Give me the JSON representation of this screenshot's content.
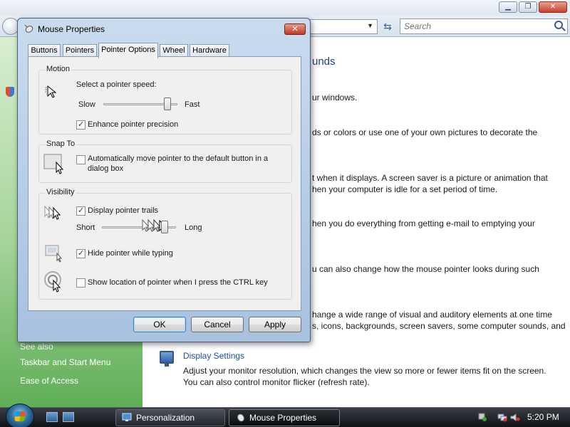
{
  "background_window": {
    "search": {
      "placeholder": "Search"
    },
    "heading_fragment": "unds",
    "lines": [
      "ur windows.",
      "ds or colors or use one of your own pictures to decorate the",
      "t when it displays. A screen saver is a picture or animation that",
      "hen your computer is idle for a set period of time.",
      "hen you do everything from getting e-mail to emptying your",
      "u can also change how the mouse pointer looks during such",
      "hange a wide range of visual and auditory elements at one time",
      "s, icons, backgrounds, screen savers, some computer sounds, and"
    ],
    "display_settings": {
      "link": "Display Settings",
      "desc_line1": "Adjust your monitor resolution, which changes the view so more or fewer items fit on the screen.",
      "desc_line2": "You can also control monitor flicker (refresh rate)."
    },
    "see_also": {
      "title": "See also",
      "links": [
        "Taskbar and Start Menu",
        "Ease of Access"
      ]
    }
  },
  "dialog": {
    "title": "Mouse Properties",
    "close_label": "✕",
    "tabs": [
      "Buttons",
      "Pointers",
      "Pointer Options",
      "Wheel",
      "Hardware"
    ],
    "active_tab": "Pointer Options",
    "motion": {
      "title": "Motion",
      "label": "Select a pointer speed:",
      "slow": "Slow",
      "fast": "Fast",
      "speed_fraction": 0.9,
      "enhance_label": "Enhance pointer precision",
      "enhance_checked": true
    },
    "snap_to": {
      "title": "Snap To",
      "label_line1": "Automatically move pointer to the default button in a",
      "label_line2": "dialog box",
      "checked": false
    },
    "visibility": {
      "title": "Visibility",
      "trails_label": "Display pointer trails",
      "trails_checked": true,
      "short": "Short",
      "long": "Long",
      "trail_fraction": 0.88,
      "hide_label": "Hide pointer while typing",
      "hide_checked": true,
      "ctrl_label": "Show location of pointer when I press the CTRL key",
      "ctrl_checked": false
    },
    "buttons": {
      "ok": "OK",
      "cancel": "Cancel",
      "apply": "Apply"
    }
  },
  "taskbar": {
    "items": [
      "Personalization",
      "Mouse Properties"
    ],
    "active": "Mouse Properties",
    "clock": "5:20 PM"
  },
  "colors": {
    "dialog_frame": "#a7c1df",
    "link_blue": "#1e4fa8",
    "panel_bg": "#f0f0f0",
    "left_pane_green": "#5fae58"
  }
}
